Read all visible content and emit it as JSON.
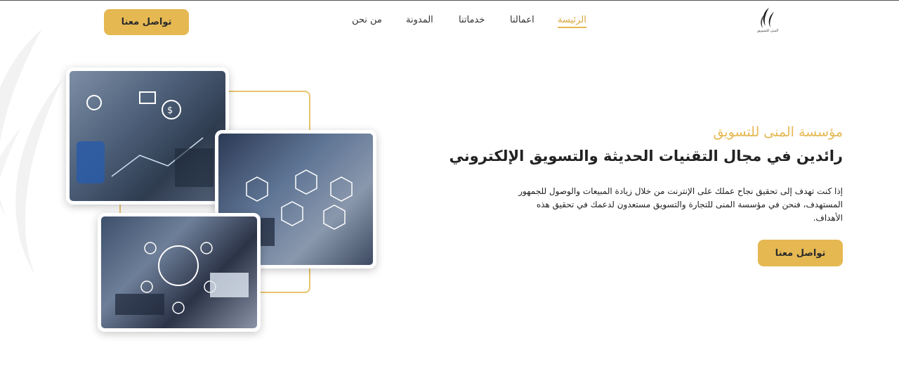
{
  "header": {
    "cta_label": "تواصل معنا",
    "nav": [
      {
        "label": "من نحن",
        "active": false
      },
      {
        "label": "المدونة",
        "active": false
      },
      {
        "label": "خدماتنا",
        "active": false
      },
      {
        "label": "اعمالنا",
        "active": false
      },
      {
        "label": "الرئيسة",
        "active": true
      }
    ],
    "logo_text": "المنى للتسويق"
  },
  "hero": {
    "kicker": "مؤسسة المنى للتسويق",
    "headline": "رائدين في مجال التقنيات الحديثة والتسويق الإلكتروني",
    "description": "إذا كنت تهدف إلى تحقيق نجاح عملك على الإنترنت من خلال زيادة المبيعات والوصول للجمهور المستهدف، فنحن في مؤسسة المنى للتجارة والتسويق مستعدون لدعمك في تحقيق هذه الأهداف.",
    "cta_label": "تواصل معنا"
  },
  "colors": {
    "accent": "#e5b852",
    "text": "#222222"
  },
  "icons": [
    "logo-mark-icon",
    "watermark-logo-icon"
  ]
}
